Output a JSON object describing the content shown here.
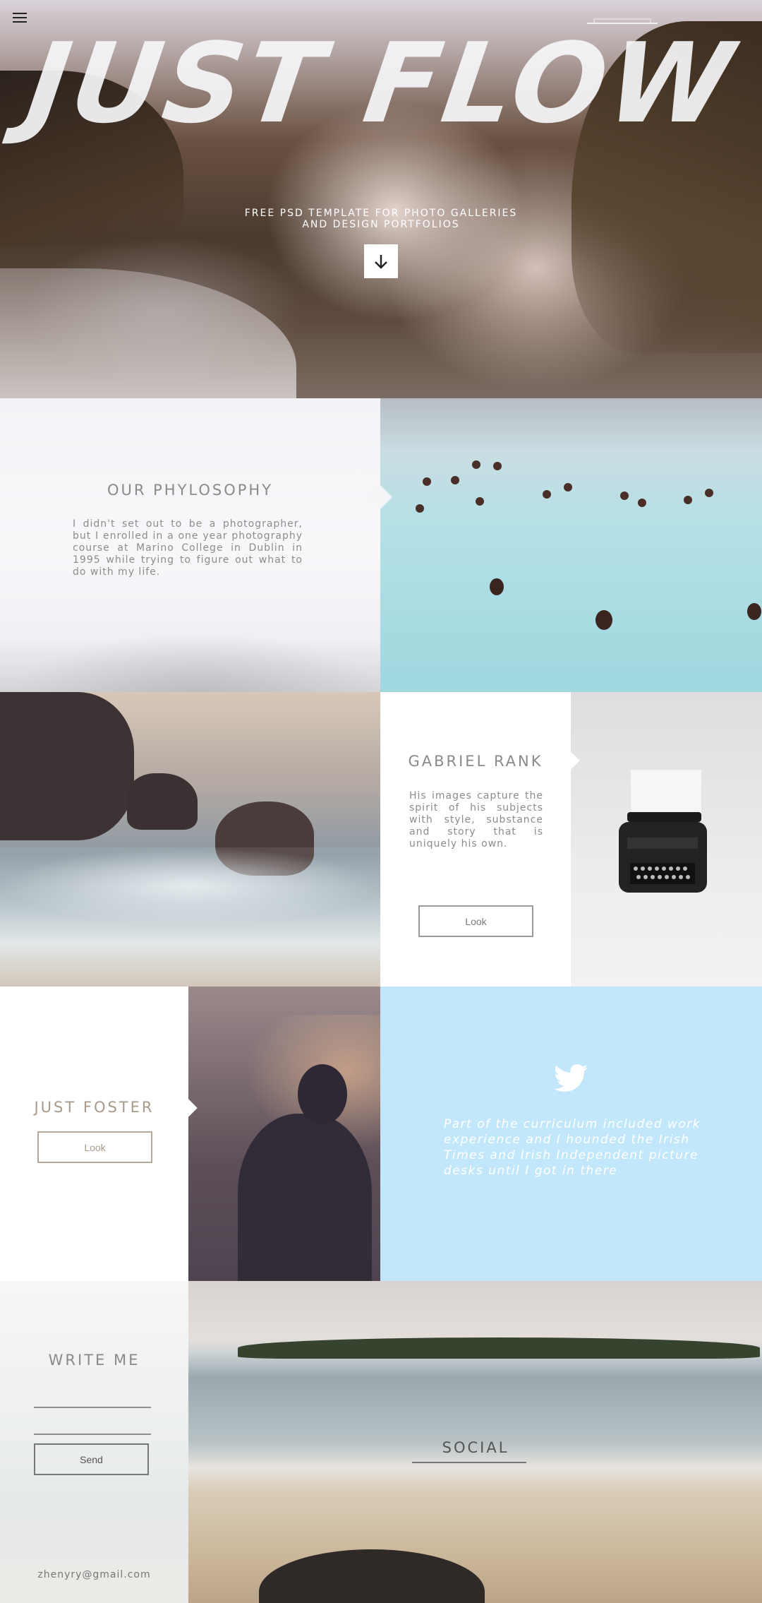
{
  "hero": {
    "title": "JUST FLOW",
    "subtitle_line1": "FREE PSD TEMPLATE FOR PHOTO GALLERIES",
    "subtitle_line2": "AND DESIGN PORTFOLIOS",
    "scroll_icon": "arrow-down-icon",
    "menu_icon": "hamburger-menu-icon"
  },
  "philosophy": {
    "heading": "OUR PHYLOSOPHY",
    "body": "I didn't set out to be a photographer, but I enrolled in a one year photography course at Marino College in Dublin in 1995 while trying to figure out what to do with my life."
  },
  "gabriel": {
    "heading": "GABRIEL RANK",
    "body": "His images capture the spirit of his subjects with style, substance and story that is uniquely his own.",
    "button": "Look"
  },
  "foster": {
    "heading": "JUST FOSTER",
    "button": "Look"
  },
  "twitter": {
    "icon": "twitter-bird-icon",
    "text": "Part of the curriculum included work experience and I hounded the Irish Times and Irish Independent picture desks until I got in there"
  },
  "contact": {
    "heading": "WRITE ME",
    "button": "Send",
    "email": "zhenyry@gmail.com"
  },
  "social": {
    "heading": "SOCIAL"
  },
  "colors": {
    "twitter_bg": "#c3e7fa",
    "accent_text": "#8a8a8a"
  }
}
